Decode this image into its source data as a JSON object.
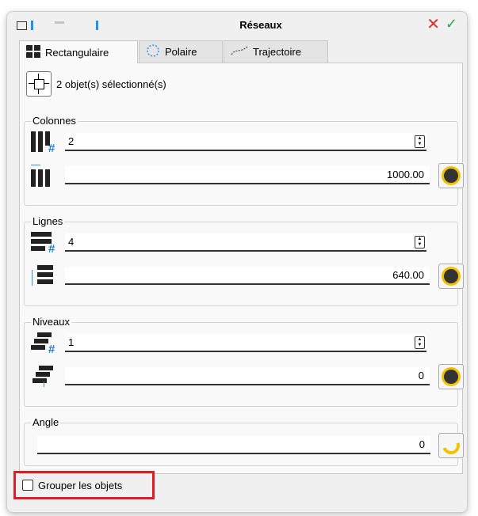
{
  "window": {
    "title": "Réseaux",
    "close_icon": "✕",
    "ok_icon": "✓"
  },
  "tabs": [
    {
      "label": "Rectangulaire",
      "icon": "grid-icon",
      "active": true
    },
    {
      "label": "Polaire",
      "icon": "polar-icon",
      "active": false
    },
    {
      "label": "Trajectoire",
      "icon": "path-icon",
      "active": false
    }
  ],
  "selection": {
    "text": "2 objet(s) sélectionné(s)",
    "icon": "select-objects-icon"
  },
  "colonnes": {
    "title": "Colonnes",
    "count": "2",
    "spacing": "1000.00"
  },
  "lignes": {
    "title": "Lignes",
    "count": "4",
    "spacing": "640.00"
  },
  "niveaux": {
    "title": "Niveaux",
    "count": "1",
    "spacing": "0"
  },
  "angle": {
    "title": "Angle",
    "value": "0"
  },
  "group_objects": {
    "label": "Grouper les objets",
    "checked": false
  },
  "colors": {
    "accent_blue": "#1e90ff",
    "close_red": "#d9302e",
    "ok_green": "#3aa14f",
    "pick_yellow": "#f2c200",
    "highlight_red": "#e01c24"
  }
}
